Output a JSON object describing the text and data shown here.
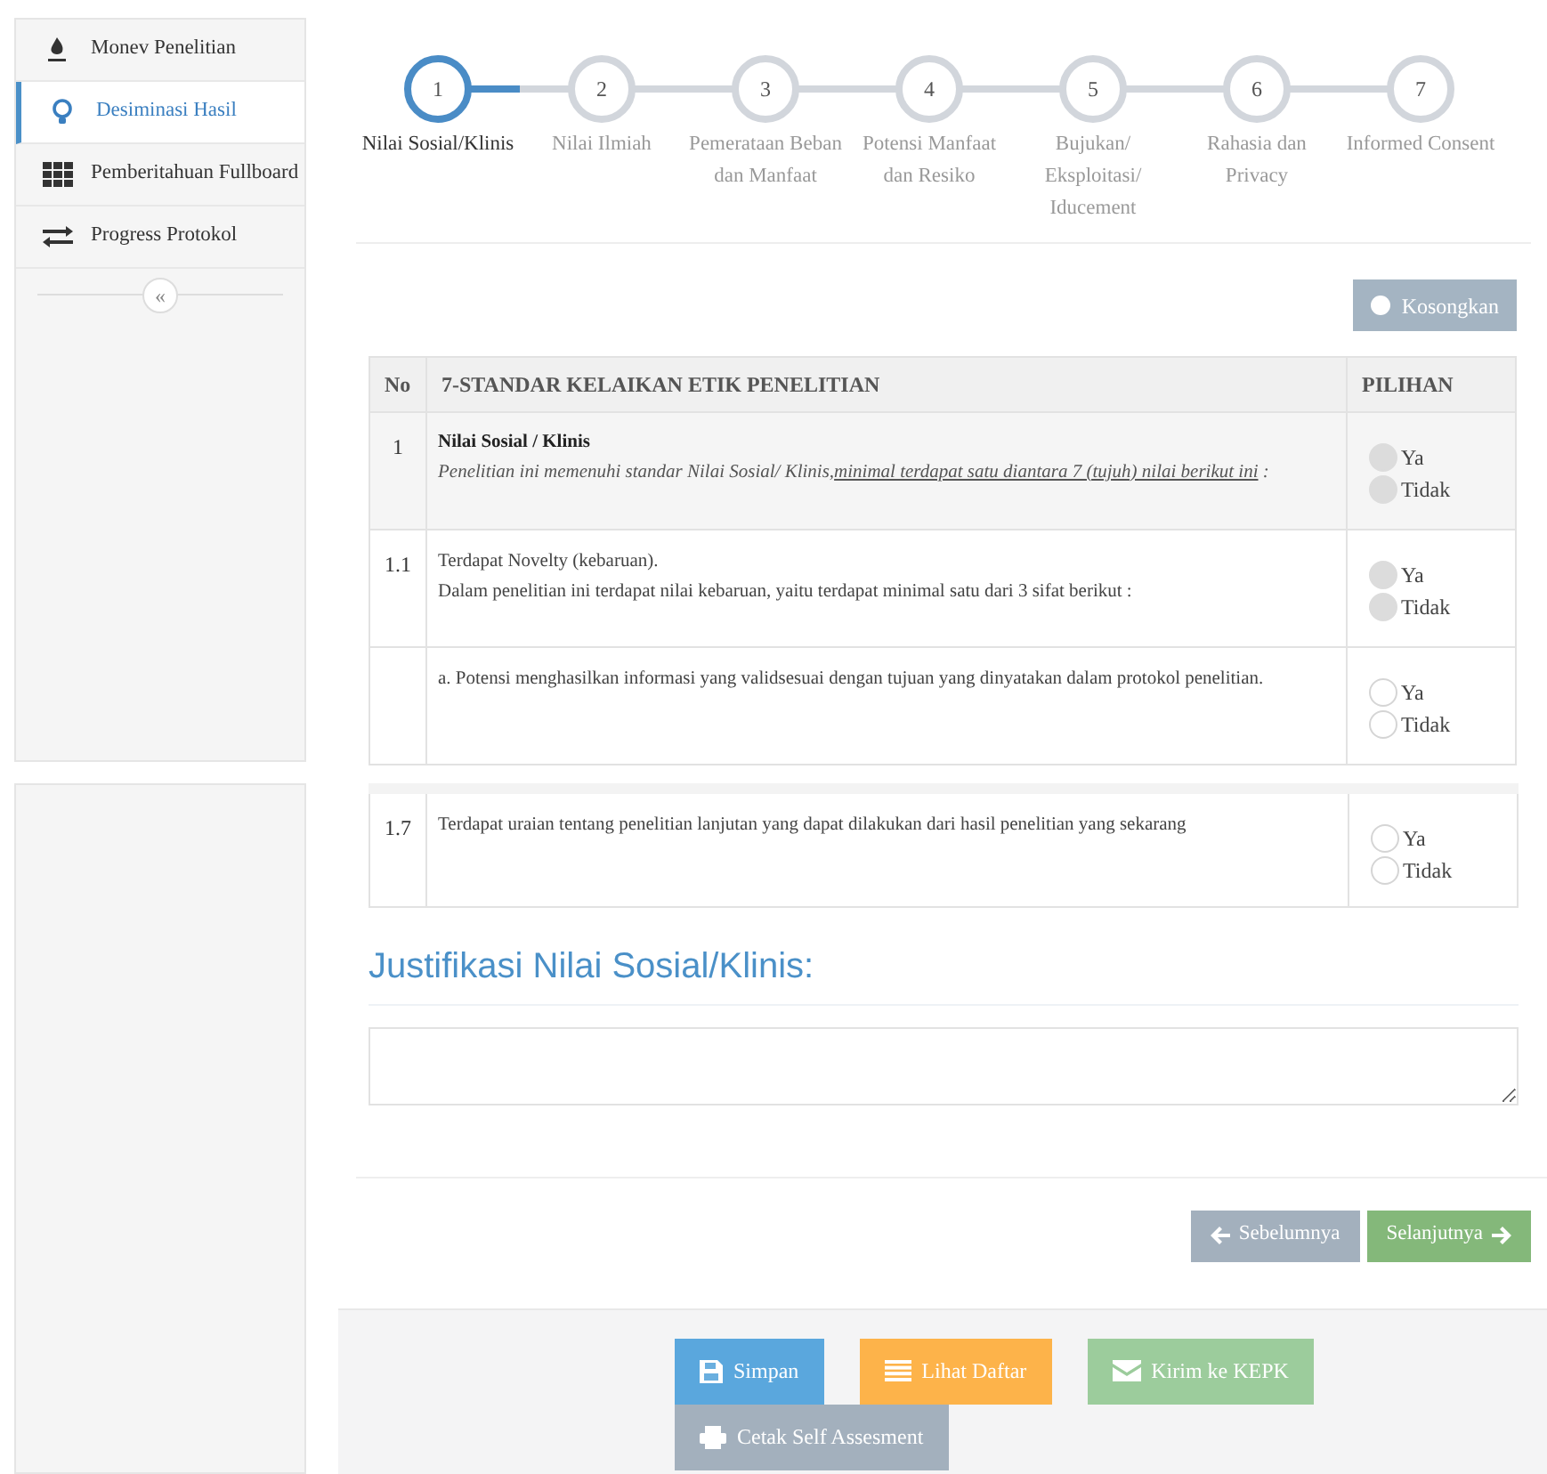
{
  "sidebar": {
    "items": [
      {
        "label": "Monev Penelitian",
        "selected": false
      },
      {
        "label": "Desiminasi Hasil",
        "selected": true
      },
      {
        "label": "Pemberitahuan Fullboard",
        "selected": false
      },
      {
        "label": "Progress Protokol",
        "selected": false
      }
    ],
    "collapse_label": "«"
  },
  "steps": [
    {
      "number": "1",
      "label": "Nilai Sosial/Klinis",
      "selected": true
    },
    {
      "number": "2",
      "label": "Nilai Ilmiah",
      "selected": false
    },
    {
      "number": "3",
      "label": "Pemerataan Beban dan Manfaat",
      "selected": false
    },
    {
      "number": "4",
      "label": "Potensi Manfaat dan Resiko",
      "selected": false
    },
    {
      "number": "5",
      "label": "Bujukan/ Eksploitasi/ Iducement",
      "selected": false
    },
    {
      "number": "6",
      "label": "Rahasia dan Privacy",
      "selected": false
    },
    {
      "number": "7",
      "label": "Informed Consent",
      "selected": false
    }
  ],
  "clear_button": "Kosongkan",
  "table": {
    "columns": [
      "No",
      "7-STANDAR KELAIKAN ETIK PENELITIAN",
      "PILIHAN"
    ],
    "rows": [
      {
        "kind": "section",
        "no": "1",
        "title": "Nilai Sosial / Klinis",
        "desc": "Penelitian ini memenuhi standar Nilai Sosial/ Klinis,",
        "desc_underlined": "minimal terdapat satu diantara 7 (tujuh) nilai berikut ini",
        "desc_end": " :",
        "disabled": true,
        "options": [
          {
            "label": "Ya",
            "checked": false
          },
          {
            "label": "Tidak",
            "checked": false
          }
        ]
      },
      {
        "kind": "item",
        "no": "1.1",
        "lines": [
          "Terdapat Novelty (kebaruan).",
          "Dalam penelitian ini terdapat nilai kebaruan, yaitu terdapat minimal satu dari 3 sifat berikut :"
        ],
        "disabled": true,
        "options": [
          {
            "label": "Ya",
            "checked": false
          },
          {
            "label": "Tidak",
            "checked": false
          }
        ]
      },
      {
        "kind": "item",
        "no": "",
        "lines": [
          "a. Potensi menghasilkan informasi yang validsesuai dengan tujuan yang dinyatakan dalam protokol penelitian."
        ],
        "disabled": false,
        "options": [
          {
            "label": "Ya",
            "checked": false
          },
          {
            "label": "Tidak",
            "checked": false
          }
        ]
      }
    ],
    "rows_after_break": [
      {
        "kind": "item",
        "no": "1.7",
        "lines": [
          "Terdapat uraian tentang penelitian lanjutan yang dapat dilakukan dari hasil penelitian yang sekarang"
        ],
        "disabled": false,
        "options": [
          {
            "label": "Ya",
            "checked": false
          },
          {
            "label": "Tidak",
            "checked": false
          }
        ]
      }
    ]
  },
  "justification": {
    "heading": "Justifikasi Nilai Sosial/Klinis:"
  },
  "nav_buttons": [
    {
      "label": "Sebelumnya",
      "kind": "prev",
      "disabled": true
    },
    {
      "label": "Selanjutnya",
      "kind": "next",
      "disabled": false
    }
  ],
  "action_buttons": [
    {
      "label": "Simpan",
      "kind": "primary",
      "disabled": false
    },
    {
      "label": "Lihat Daftar",
      "kind": "warning",
      "disabled": false
    },
    {
      "label": "Kirim ke KEPK",
      "kind": "success",
      "disabled": true
    },
    {
      "label": "Cetak Self Assesment",
      "kind": "default",
      "disabled": true
    }
  ]
}
